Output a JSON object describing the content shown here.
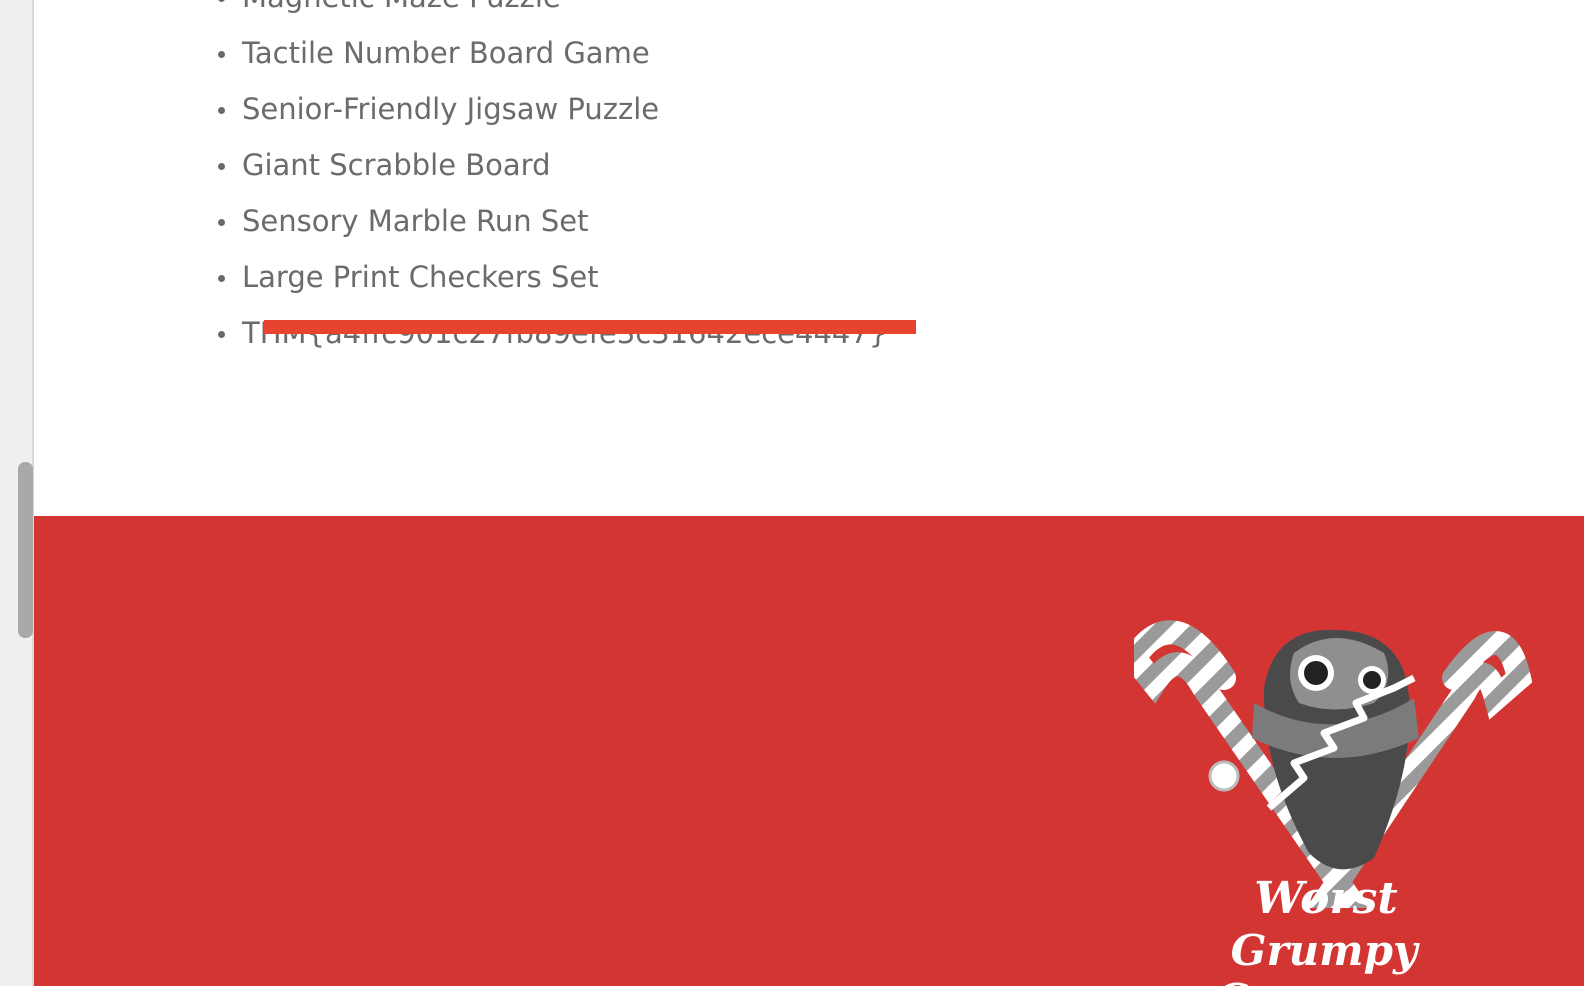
{
  "list": {
    "items": [
      "Magnetic Maze Puzzle",
      "Tactile Number Board Game",
      "Senior-Friendly Jigsaw Puzzle",
      "Giant Scrabble Board",
      "Sensory Marble Run Set",
      "Large Print Checkers Set",
      "THM{a4ffc901c27fb89efe3c31642ece4447}"
    ]
  },
  "footer": {
    "logo_line1": "Worst",
    "logo_line2": "Grumpy Company",
    "background_color": "#d23532"
  },
  "colors": {
    "redaction": "#e8432f",
    "list_text": "#6b6b6b"
  }
}
